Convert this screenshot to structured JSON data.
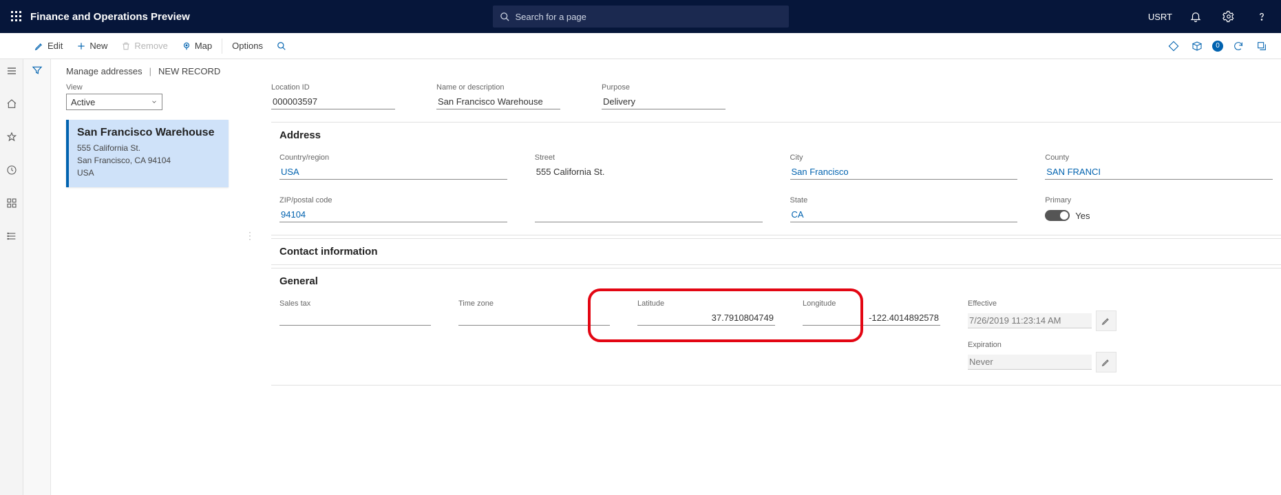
{
  "header": {
    "app_title": "Finance and Operations Preview",
    "search_placeholder": "Search for a page",
    "user": "USRT"
  },
  "toolbar": {
    "edit": "Edit",
    "new": "New",
    "remove": "Remove",
    "map": "Map",
    "options": "Options",
    "attach_count": "0"
  },
  "breadcrumb": {
    "main": "Manage addresses",
    "record": "NEW RECORD"
  },
  "view": {
    "label": "View",
    "value": "Active"
  },
  "card": {
    "title": "San Francisco Warehouse",
    "line1": "555 California St.",
    "line2": "San Francisco, CA 94104",
    "line3": "USA"
  },
  "head_fields": {
    "location_id_label": "Location ID",
    "location_id": "000003597",
    "name_label": "Name or description",
    "name": "San Francisco Warehouse",
    "purpose_label": "Purpose",
    "purpose": "Delivery"
  },
  "sections": {
    "address": "Address",
    "contact": "Contact information",
    "general": "General"
  },
  "address": {
    "country_label": "Country/region",
    "country": "USA",
    "street_label": "Street",
    "street": "555 California St.",
    "city_label": "City",
    "city": "San Francisco",
    "county_label": "County",
    "county": "SAN FRANCI",
    "zip_label": "ZIP/postal code",
    "zip": "94104",
    "state_label": "State",
    "state": "CA",
    "primary_label": "Primary",
    "primary_value": "Yes"
  },
  "general": {
    "salestax_label": "Sales tax",
    "timezone_label": "Time zone",
    "lat_label": "Latitude",
    "lat": "37.7910804749",
    "lon_label": "Longitude",
    "lon": "-122.4014892578",
    "effective_label": "Effective",
    "effective": "7/26/2019 11:23:14 AM",
    "expiration_label": "Expiration",
    "expiration": "Never"
  }
}
